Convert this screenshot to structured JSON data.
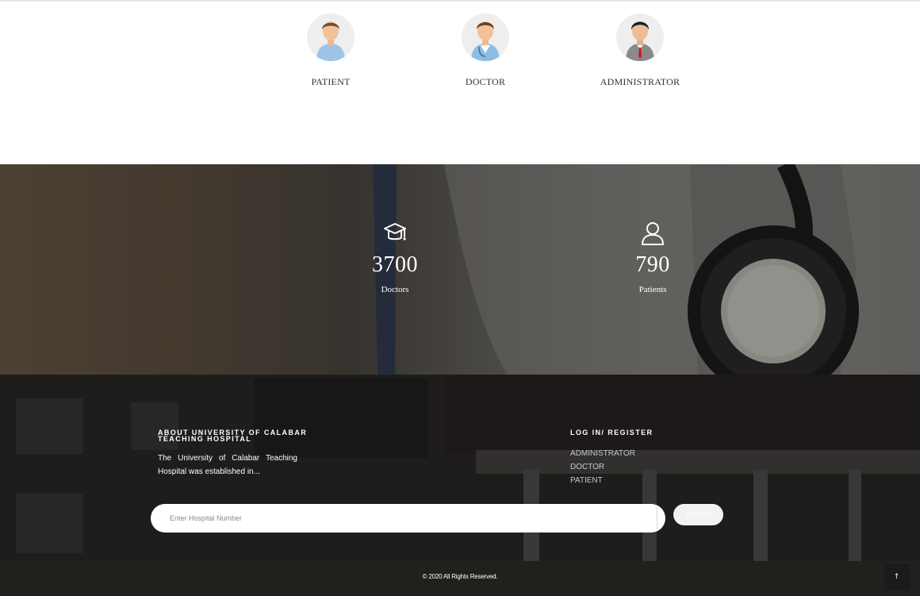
{
  "roles": [
    {
      "label": "PATIENT",
      "icon": "patient-avatar-icon"
    },
    {
      "label": "DOCTOR",
      "icon": "doctor-avatar-icon"
    },
    {
      "label": "ADMINISTRATOR",
      "icon": "administrator-avatar-icon"
    }
  ],
  "stats": [
    {
      "value": "3700",
      "label": "Doctors",
      "icon": "graduation-cap-icon"
    },
    {
      "value": "790",
      "label": "Patients",
      "icon": "user-icon"
    }
  ],
  "footer": {
    "about_heading": "ABOUT UNIVERSITY OF CALABAR TEACHING HOSPITAL",
    "about_text": "The University of Calabar Teaching Hospital was established in...",
    "links_heading": "LOG IN/ REGISTER",
    "links": [
      "ADMINISTRATOR",
      "DOCTOR",
      "PATIENT"
    ],
    "search": {
      "placeholder": "Enter Hospital Number",
      "button_label": "Search"
    },
    "copyright": "© 2020 All Rights Reserved.",
    "to_top_icon": "arrow-up-icon",
    "to_top_label": "↑"
  },
  "colors": {
    "footer_bg": "#2c2a28",
    "stat_text": "#ffffff",
    "link_text": "#c9c9c9"
  }
}
